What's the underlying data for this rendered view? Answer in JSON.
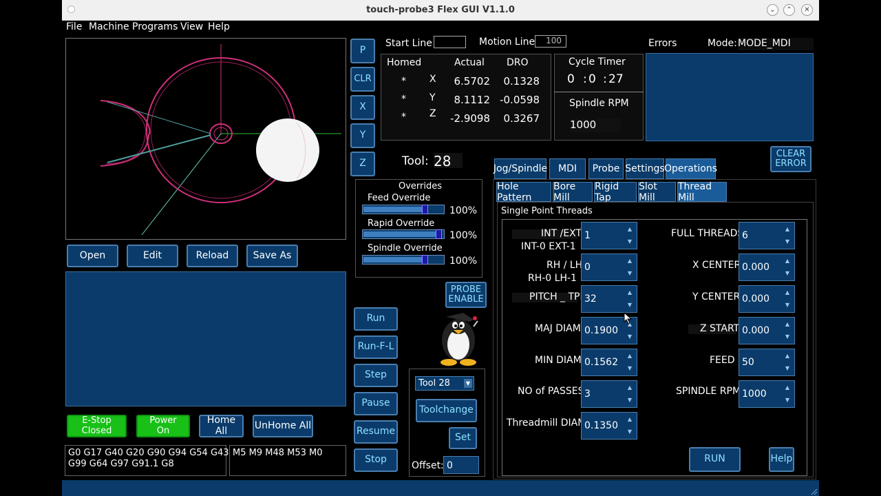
{
  "window": {
    "title": "touch-probe3 Flex GUI V1.1.0"
  },
  "menu": [
    "File",
    "Machine",
    "Programs",
    "View",
    "Help"
  ],
  "axis_buttons": [
    "P",
    "CLR",
    "X",
    "Y",
    "Z"
  ],
  "file_buttons": [
    "Open",
    "Edit",
    "Reload",
    "Save As"
  ],
  "run_buttons": [
    "Run",
    "Run-F-L",
    "Step",
    "Pause",
    "Resume",
    "Stop"
  ],
  "estop": "E-Stop\nClosed",
  "power": "Power\nOn",
  "home_all": "Home All",
  "unhome_all": "UnHome All",
  "gcodes": "G0 G17 G40 G20 G90 G94 G54 G43\nG99 G64 G97 G91.1 G8",
  "mcodes": "M5 M9 M48 M53 M0",
  "start_line": {
    "label": "Start Line",
    "value": ""
  },
  "motion_line": {
    "label": "Motion Line",
    "value": "100"
  },
  "dro": {
    "headers": [
      "Homed",
      "Actual",
      "DRO"
    ],
    "rows": [
      {
        "homed": "*",
        "axis": "X",
        "actual": "6.5702",
        "dro": "0.1328"
      },
      {
        "homed": "*",
        "axis": "Y",
        "actual": "8.1112",
        "dro": "-0.0598"
      },
      {
        "homed": "*",
        "axis": "Z",
        "actual": "-2.9098",
        "dro": "0.3267"
      }
    ]
  },
  "cycle_timer": {
    "label": "Cycle Timer",
    "h": "0",
    "m": "0",
    "s": "27",
    "sep1": ":",
    "sep2": ":"
  },
  "spindle": {
    "label": "Spindle RPM",
    "value": "1000"
  },
  "errors": {
    "label": "Errors"
  },
  "mode": {
    "label": "Mode:",
    "value": "MODE_MDI"
  },
  "clear_error": "CLEAR\nERROR",
  "tool": {
    "label": "Tool:",
    "value": "28"
  },
  "overrides": {
    "title": "Overrides",
    "items": [
      {
        "label": "Feed Override",
        "value": "100%",
        "pct": 0.78
      },
      {
        "label": "Rapid Override",
        "value": "100%",
        "pct": 0.95
      },
      {
        "label": "Spindle Override",
        "value": "100%",
        "pct": 0.78
      }
    ]
  },
  "probe_enable": "PROBE\nENABLE",
  "toolchange": {
    "select": "Tool 28",
    "button": "Toolchange",
    "set": "Set",
    "offset_label": "Offset:",
    "offset_value": "0"
  },
  "main_tabs": [
    "Jog/Spindle",
    "MDI",
    "Probe",
    "Settings",
    "Operations"
  ],
  "sub_tabs": [
    "Hole Pattern",
    "Bore Mill",
    "Rigid Tap",
    "Slot Mill",
    "Thread Mill"
  ],
  "thread": {
    "title": "Single Point Threads",
    "left": [
      {
        "label": "INT /EXT",
        "sub": "INT-0  EXT-1",
        "value": "1"
      },
      {
        "label": "RH / LH",
        "sub": "RH-0  LH-1",
        "value": "0"
      },
      {
        "label": "PITCH _ TPI",
        "sub": "",
        "value": "32"
      },
      {
        "label": "MAJ DIAM",
        "sub": "",
        "value": "0.1900"
      },
      {
        "label": "MIN DIAM",
        "sub": "",
        "value": "0.1562"
      },
      {
        "label": "NO of PASSES",
        "sub": "",
        "value": "3"
      },
      {
        "label": "Threadmill DIAM",
        "sub": "",
        "value": "0.1350"
      }
    ],
    "right": [
      {
        "label": "FULL THREADS",
        "value": "6"
      },
      {
        "label": "X CENTER",
        "value": "0.000"
      },
      {
        "label": "Y CENTER",
        "value": "0.000"
      },
      {
        "label": "Z START",
        "value": "0.000"
      },
      {
        "label": "FEED",
        "value": "50"
      },
      {
        "label": "SPINDLE RPM",
        "value": "1000"
      }
    ],
    "run": "RUN",
    "help": "Help"
  },
  "colors": {
    "button_bg": "#0a3b6a",
    "green": "#18c018",
    "toolpath": "#d0307a"
  }
}
